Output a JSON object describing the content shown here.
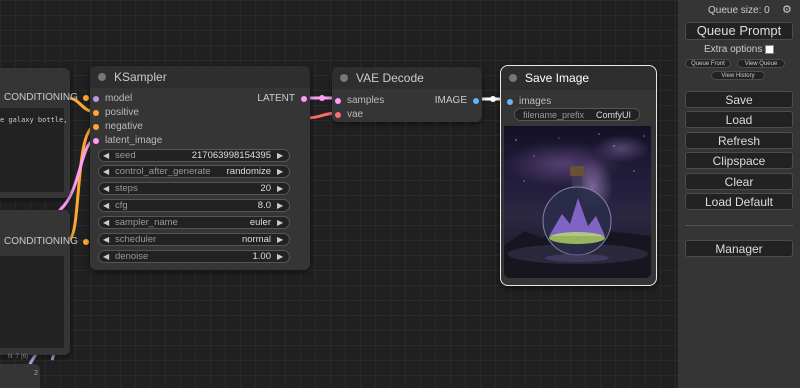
{
  "colors": {
    "conditioning": "#ffa931",
    "latent": "#ff9cf9",
    "image": "#64b5f6",
    "vae": "#ff6e6e",
    "model": "#b39ddb"
  },
  "left_nodes": {
    "top_output": "CONDITIONING",
    "top_text": "e galaxy bottle,",
    "bottom_output": "CONDITIONING",
    "footer_text": "N: 7 (6)",
    "footer_num": "2"
  },
  "ksampler": {
    "title": "KSampler",
    "inputs": [
      "model",
      "positive",
      "negative",
      "latent_image"
    ],
    "output": "LATENT",
    "widgets": [
      {
        "label": "seed",
        "value": "217063998154395"
      },
      {
        "label": "control_after_generate",
        "value": "randomize"
      },
      {
        "label": "steps",
        "value": "20"
      },
      {
        "label": "cfg",
        "value": "8.0"
      },
      {
        "label": "sampler_name",
        "value": "euler"
      },
      {
        "label": "scheduler",
        "value": "normal"
      },
      {
        "label": "denoise",
        "value": "1.00"
      }
    ]
  },
  "vae_decode": {
    "title": "VAE Decode",
    "inputs": [
      "samples",
      "vae"
    ],
    "output": "IMAGE"
  },
  "save_image": {
    "title": "Save Image",
    "input": "images",
    "filename_prefix_label": "filename_prefix",
    "filename_prefix_value": "ComfyUI"
  },
  "panel": {
    "queue_size": "Queue size: 0",
    "queue_prompt": "Queue Prompt",
    "extra_options": "Extra options",
    "queue_front": "Queue Front",
    "view_queue": "View Queue",
    "view_history": "View History",
    "save": "Save",
    "load": "Load",
    "refresh": "Refresh",
    "clipspace": "Clipspace",
    "clear": "Clear",
    "load_default": "Load Default",
    "manager": "Manager"
  }
}
